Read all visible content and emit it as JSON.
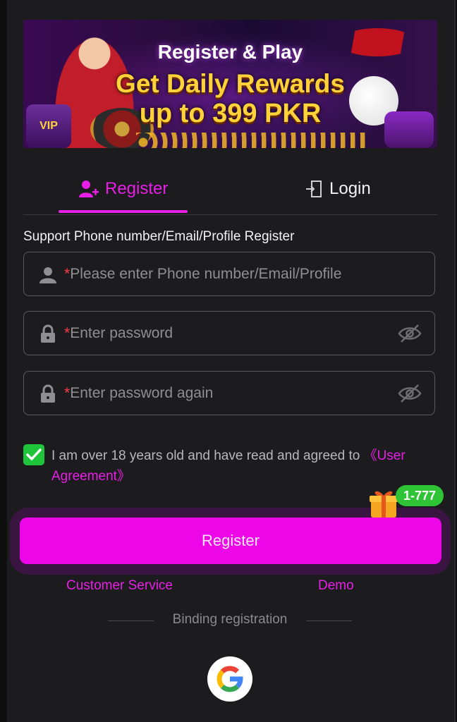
{
  "banner": {
    "line1": "Register & Play",
    "line2": "Get Daily Rewards",
    "line3": "up to 399 PKR",
    "vip_label": "VIP"
  },
  "tabs": [
    {
      "label": "Register",
      "icon": "user-add-icon",
      "active": true
    },
    {
      "label": "Login",
      "icon": "login-door-icon",
      "active": false
    }
  ],
  "form": {
    "support_text": "Support Phone number/Email/Profile Register",
    "required_mark": "*",
    "fields": [
      {
        "placeholder": "Please enter Phone number/Email/Profile",
        "icon": "user-icon"
      },
      {
        "placeholder": "Enter password",
        "icon": "lock-icon",
        "toggle_icon": "eye-off-icon"
      },
      {
        "placeholder": "Enter password again",
        "icon": "lock-icon",
        "toggle_icon": "eye-off-icon"
      }
    ],
    "agreement_text": "I am over 18 years old and have read and agreed to ",
    "agreement_link": "《User Agreement》",
    "agreement_checked": true
  },
  "promo_badge": "1-777",
  "register_button": "Register",
  "links": {
    "customer_service": "Customer Service",
    "demo": "Demo"
  },
  "binding_label": "Binding registration",
  "colors": {
    "accent": "#e81fe6",
    "button": "#ec06e8",
    "background": "#1c1c1e",
    "check": "#1ec43a"
  }
}
